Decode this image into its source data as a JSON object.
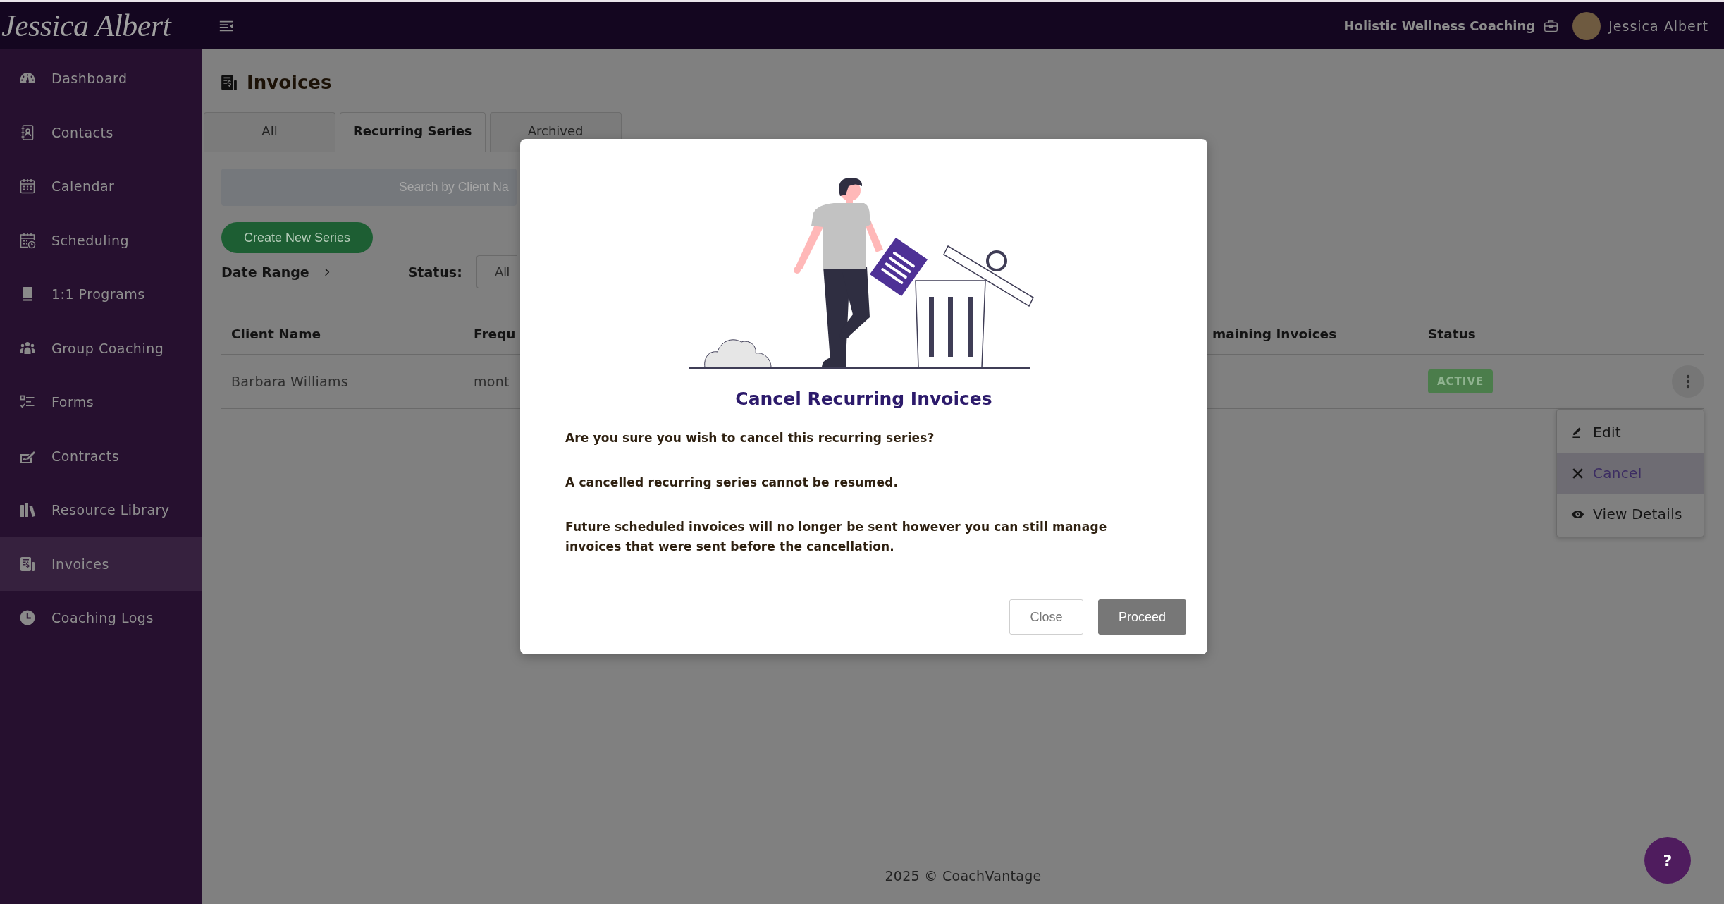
{
  "top_bar": {
    "logo": "Jessica Albert",
    "business": "Holistic Wellness Coaching",
    "user_name": "Jessica Albert"
  },
  "sidebar": {
    "items": [
      {
        "label": "Dashboard",
        "selected": false
      },
      {
        "label": "Contacts",
        "selected": false
      },
      {
        "label": "Calendar",
        "selected": false
      },
      {
        "label": "Scheduling",
        "selected": false
      },
      {
        "label": "1:1 Programs",
        "selected": false
      },
      {
        "label": "Group Coaching",
        "selected": false
      },
      {
        "label": "Forms",
        "selected": false
      },
      {
        "label": "Contracts",
        "selected": false
      },
      {
        "label": "Resource Library",
        "selected": false
      },
      {
        "label": "Invoices",
        "selected": true
      },
      {
        "label": "Coaching Logs",
        "selected": false
      }
    ]
  },
  "page": {
    "title": "Invoices",
    "tabs": [
      {
        "label": "All",
        "selected": false
      },
      {
        "label": "Recurring Series",
        "selected": true
      },
      {
        "label": "Archived",
        "selected": false
      }
    ],
    "search": {
      "placeholder": "Search by Client Na"
    },
    "create_button": "Create New Series",
    "filters": {
      "date_range": "Date Range",
      "status_label": "Status:",
      "status_value": "All"
    },
    "table": {
      "columns": [
        "Client Name",
        "Frequ",
        "maining Invoices",
        "Status"
      ],
      "rows": [
        {
          "client": "Barbara Williams",
          "column_2": "mont",
          "status": "ACTIVE",
          "menu_open": true
        }
      ]
    },
    "row_menu": {
      "items": [
        {
          "label": "Edit",
          "selected": false
        },
        {
          "label": "Cancel",
          "selected": true
        },
        {
          "label": "View Details",
          "selected": false
        }
      ]
    }
  },
  "footer": {
    "text": "2025 © CoachVantage"
  },
  "help_button": {
    "label": "?"
  },
  "modal": {
    "title": "Cancel Recurring Invoices",
    "paragraphs": [
      "Are you sure you wish to cancel this recurring series?",
      "A cancelled recurring series cannot be resumed.",
      "Future scheduled invoices will no longer be sent however you can still manage invoices that were sent before the cancellation."
    ],
    "buttons": [
      {
        "label": "Close",
        "kind": "secondary"
      },
      {
        "label": "Proceed",
        "kind": "primary"
      }
    ]
  }
}
